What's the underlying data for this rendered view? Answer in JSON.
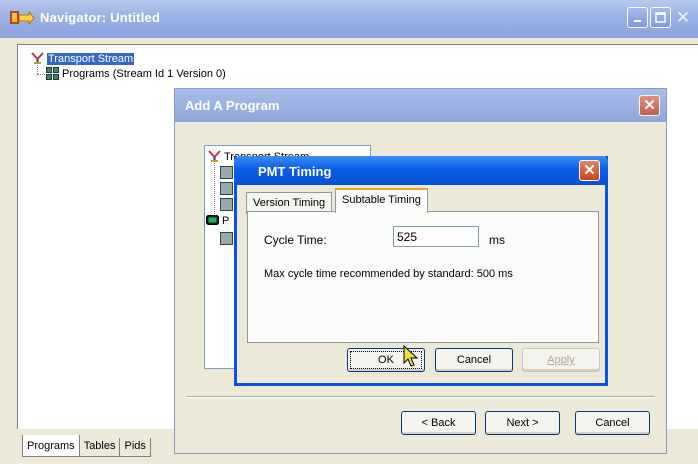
{
  "navigator": {
    "title": "Navigator: Untitled",
    "tree": {
      "root": "Transport Stream",
      "child": "Programs (Stream Id 1 Version 0)"
    },
    "tabs": [
      "Programs",
      "Tables",
      "Pids"
    ]
  },
  "add_program": {
    "title": "Add A Program",
    "tree_root": "Transport Stream",
    "tree_partial_item": "P",
    "back_label": "< Back",
    "next_label": "Next >",
    "cancel_label": "Cancel"
  },
  "pmt_timing": {
    "title": "PMT Timing",
    "tabs": [
      "Version Timing",
      "Subtable Timing"
    ],
    "active_tab": "Subtable Timing",
    "cycle_time_label": "Cycle Time:",
    "cycle_time_value": "525",
    "cycle_time_unit": "ms",
    "note": "Max cycle time recommended by standard: 500 ms",
    "ok_label": "OK",
    "cancel_label": "Cancel",
    "apply_label": "Apply"
  },
  "colors": {
    "active_title": "#0a5de8",
    "inactive_title": "#9db3e4",
    "selection": "#316ac5",
    "tab_highlight": "#f0a030"
  }
}
